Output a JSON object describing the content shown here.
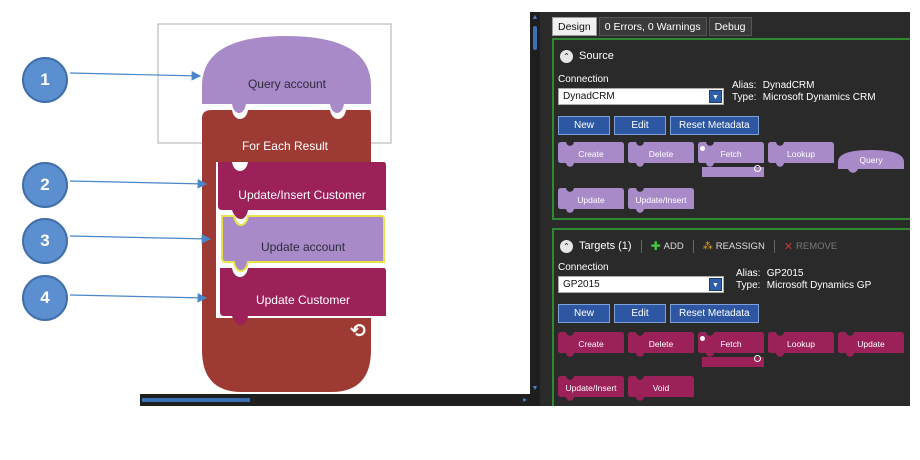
{
  "colors": {
    "query_purple": "#a98ac9",
    "container_red": "#9c3a33",
    "block_magenta": "#9b2158",
    "highlight_yellow": "#e8e34a",
    "callout_blue": "#5b8fd0",
    "section_green": "#2f8a2f",
    "button_blue": "#2e57a3"
  },
  "callouts": [
    "1",
    "2",
    "3",
    "4"
  ],
  "flow": {
    "query_label": "Query account",
    "foreach_label": "For Each Result",
    "blocks": [
      "Update/Insert Customer",
      "Update account",
      "Update Customer"
    ],
    "loop_icon": "reload-icon"
  },
  "tabs": [
    "Design",
    "0 Errors, 0 Warnings",
    "Debug"
  ],
  "source": {
    "title": "Source",
    "connection_label": "Connection",
    "connection_value": "DynadCRM",
    "alias_key": "Alias:",
    "alias_value": "DynadCRM",
    "type_key": "Type:",
    "type_value": "Microsoft Dynamics CRM",
    "buttons": [
      "New",
      "Edit",
      "Reset Metadata"
    ],
    "ops": [
      "Create",
      "Delete",
      "Fetch",
      "Lookup",
      "Query",
      "Update",
      "Update/Insert"
    ]
  },
  "targets": {
    "title": "Targets (1)",
    "add_label": "ADD",
    "reassign_label": "REASSIGN",
    "remove_label": "REMOVE",
    "connection_label": "Connection",
    "connection_value": "GP2015",
    "alias_key": "Alias:",
    "alias_value": "GP2015",
    "type_key": "Type:",
    "type_value": "Microsoft Dynamics GP",
    "buttons": [
      "New",
      "Edit",
      "Reset Metadata"
    ],
    "ops": [
      "Create",
      "Delete",
      "Fetch",
      "Lookup",
      "Update",
      "Update/Insert",
      "Void"
    ]
  }
}
